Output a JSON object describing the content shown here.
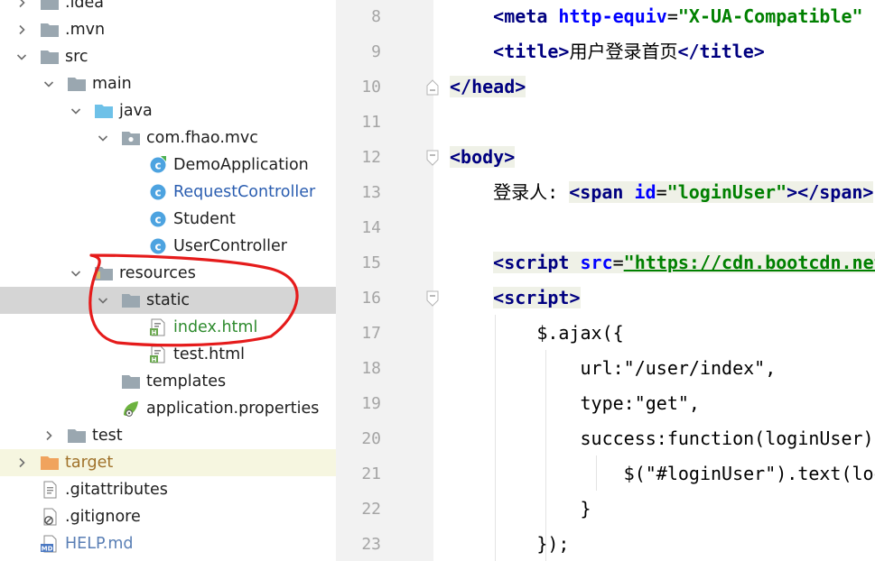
{
  "tree": {
    "items": [
      {
        "label": ".idea",
        "indent": 0,
        "arrow": "right",
        "icon": "folder-icon"
      },
      {
        "label": ".mvn",
        "indent": 0,
        "arrow": "right",
        "icon": "folder-icon"
      },
      {
        "label": "src",
        "indent": 0,
        "arrow": "down",
        "icon": "folder-icon"
      },
      {
        "label": "main",
        "indent": 1,
        "arrow": "down",
        "icon": "folder-icon"
      },
      {
        "label": "java",
        "indent": 2,
        "arrow": "down",
        "icon": "source-folder-icon"
      },
      {
        "label": "com.fhao.mvc",
        "indent": 3,
        "arrow": "down",
        "icon": "package-icon"
      },
      {
        "label": "DemoApplication",
        "indent": 4,
        "arrow": "",
        "icon": "spring-boot-class-icon"
      },
      {
        "label": "RequestController",
        "indent": 4,
        "arrow": "",
        "icon": "class-icon",
        "color": "#2a5db0"
      },
      {
        "label": "Student",
        "indent": 4,
        "arrow": "",
        "icon": "class-icon"
      },
      {
        "label": "UserController",
        "indent": 4,
        "arrow": "",
        "icon": "class-icon"
      },
      {
        "label": "resources",
        "indent": 2,
        "arrow": "down",
        "icon": "resources-folder-icon"
      },
      {
        "label": "static",
        "indent": 3,
        "arrow": "down",
        "icon": "folder-icon",
        "selected": true
      },
      {
        "label": "index.html",
        "indent": 4,
        "arrow": "",
        "icon": "html-file-icon",
        "color": "#2e8b2e"
      },
      {
        "label": "test.html",
        "indent": 4,
        "arrow": "",
        "icon": "html-file-icon"
      },
      {
        "label": "templates",
        "indent": 3,
        "arrow": "",
        "icon": "folder-icon"
      },
      {
        "label": "application.properties",
        "indent": 3,
        "arrow": "",
        "icon": "spring-properties-icon"
      },
      {
        "label": "test",
        "indent": 1,
        "arrow": "right",
        "icon": "folder-icon"
      },
      {
        "label": "target",
        "indent": 0,
        "arrow": "right",
        "icon": "excluded-folder-icon",
        "color": "#a0722a",
        "ignored": true
      },
      {
        "label": ".gitattributes",
        "indent": 0,
        "arrow": "",
        "icon": "text-file-icon"
      },
      {
        "label": ".gitignore",
        "indent": 0,
        "arrow": "",
        "icon": "gitignore-file-icon"
      },
      {
        "label": "HELP.md",
        "indent": 0,
        "arrow": "",
        "icon": "markdown-file-icon",
        "color": "#5a7fb5"
      }
    ]
  },
  "editor": {
    "lines": [
      {
        "num": "8",
        "fold": "",
        "segments": [
          {
            "t": "    ",
            "c": ""
          },
          {
            "t": "<meta ",
            "c": "tg"
          },
          {
            "t": "http-equiv",
            "c": "at"
          },
          {
            "t": "=",
            "c": ""
          },
          {
            "t": "\"X-UA-Compatible\"",
            "c": "av"
          }
        ]
      },
      {
        "num": "9",
        "fold": "",
        "segments": [
          {
            "t": "    ",
            "c": ""
          },
          {
            "t": "<title>",
            "c": "tg"
          },
          {
            "t": "用户登录首页",
            "c": ""
          },
          {
            "t": "</title>",
            "c": "tg"
          }
        ]
      },
      {
        "num": "10",
        "fold": "end",
        "segments": [
          {
            "t": "</head>",
            "c": "tg bg"
          }
        ]
      },
      {
        "num": "11",
        "fold": "",
        "segments": []
      },
      {
        "num": "12",
        "fold": "start",
        "segments": [
          {
            "t": "<body>",
            "c": "tg bg"
          }
        ]
      },
      {
        "num": "13",
        "fold": "",
        "segments": [
          {
            "t": "    ",
            "c": ""
          },
          {
            "t": "登录人: ",
            "c": ""
          },
          {
            "t": "<span ",
            "c": "tg bg"
          },
          {
            "t": "id",
            "c": "at bg"
          },
          {
            "t": "=",
            "c": "bg"
          },
          {
            "t": "\"loginUser\"",
            "c": "av bg"
          },
          {
            "t": "></span>",
            "c": "tg bg"
          }
        ]
      },
      {
        "num": "14",
        "fold": "",
        "segments": []
      },
      {
        "num": "15",
        "fold": "",
        "segments": [
          {
            "t": "    ",
            "c": ""
          },
          {
            "t": "<script ",
            "c": "tg bg"
          },
          {
            "t": "src",
            "c": "at bg"
          },
          {
            "t": "=",
            "c": "bg"
          },
          {
            "t": "\"https://cdn.bootcdn.net\"",
            "c": "av ul bg"
          }
        ]
      },
      {
        "num": "16",
        "fold": "start",
        "segments": [
          {
            "t": "    ",
            "c": ""
          },
          {
            "t": "<script>",
            "c": "tg bg"
          }
        ]
      },
      {
        "num": "17",
        "fold": "",
        "segments": [
          {
            "t": "        $.ajax({",
            "c": ""
          }
        ]
      },
      {
        "num": "18",
        "fold": "",
        "segments": [
          {
            "t": "            url:\"/user/index\",",
            "c": ""
          }
        ]
      },
      {
        "num": "19",
        "fold": "",
        "segments": [
          {
            "t": "            type:\"get\",",
            "c": ""
          }
        ]
      },
      {
        "num": "20",
        "fold": "",
        "segments": [
          {
            "t": "            success:function(loginUser){",
            "c": ""
          }
        ]
      },
      {
        "num": "21",
        "fold": "",
        "segments": [
          {
            "t": "                $(\"#loginUser\").text(loginUser);",
            "c": ""
          }
        ]
      },
      {
        "num": "22",
        "fold": "",
        "segments": [
          {
            "t": "            }",
            "c": ""
          }
        ]
      },
      {
        "num": "23",
        "fold": "",
        "segments": [
          {
            "t": "        });",
            "c": ""
          }
        ]
      }
    ]
  }
}
